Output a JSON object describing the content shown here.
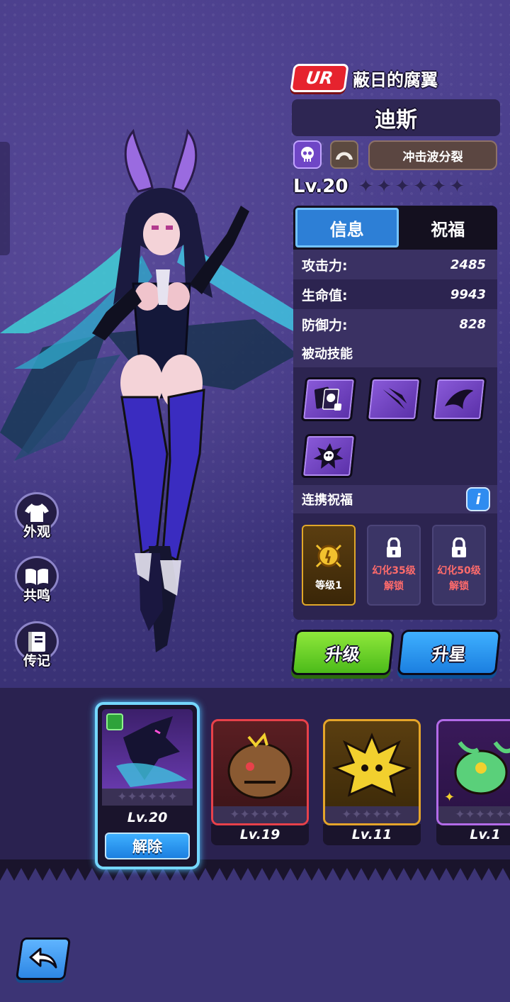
{
  "header": {
    "rarity": "UR",
    "weapon_name": "蔽日的腐翼",
    "character_name": "迪斯",
    "skill_tag": "冲击波分裂",
    "level": "Lv.20"
  },
  "stars": {
    "filled": 0,
    "total": 6
  },
  "tabs": [
    {
      "label": "信息",
      "active": true
    },
    {
      "label": "祝福",
      "active": false
    }
  ],
  "stats": [
    {
      "label": "攻击力:",
      "value": "2485"
    },
    {
      "label": "生命值:",
      "value": "9943"
    },
    {
      "label": "防御力:",
      "value": "828"
    }
  ],
  "passive_title": "被动技能",
  "passives": [
    "cards-skull-icon",
    "claw-slash-icon",
    "wing-icon",
    "skull-burst-icon"
  ],
  "bless_title": "连携祝福",
  "bless_info": "i",
  "blessings": [
    {
      "label": "等级1",
      "locked": false
    },
    {
      "line1": "幻化35级",
      "line2": "解锁",
      "locked": true
    },
    {
      "line1": "幻化50级",
      "line2": "解锁",
      "locked": true
    }
  ],
  "buttons": {
    "upgrade": "升级",
    "star_up": "升星",
    "unequip": "解除"
  },
  "side_menu": [
    {
      "label": "外观",
      "icon": "shirt-icon"
    },
    {
      "label": "共鸣",
      "icon": "book-icon"
    },
    {
      "label": "传记",
      "icon": "journal-icon"
    }
  ],
  "roster": [
    {
      "level": "Lv.20",
      "frame": "#75d7ff",
      "selected": true
    },
    {
      "level": "Lv.19",
      "frame": "#e8414a",
      "selected": false
    },
    {
      "level": "Lv.11",
      "frame": "#e5a52a",
      "selected": false
    },
    {
      "level": "Lv.1",
      "frame": "#b36be8",
      "selected": false
    }
  ],
  "colors": {
    "background": "#3d3575",
    "ur_red": "#e6232e",
    "tab_blue": "#2d7fd6",
    "green": "#4cbb1a",
    "blue": "#1b7fe0"
  }
}
